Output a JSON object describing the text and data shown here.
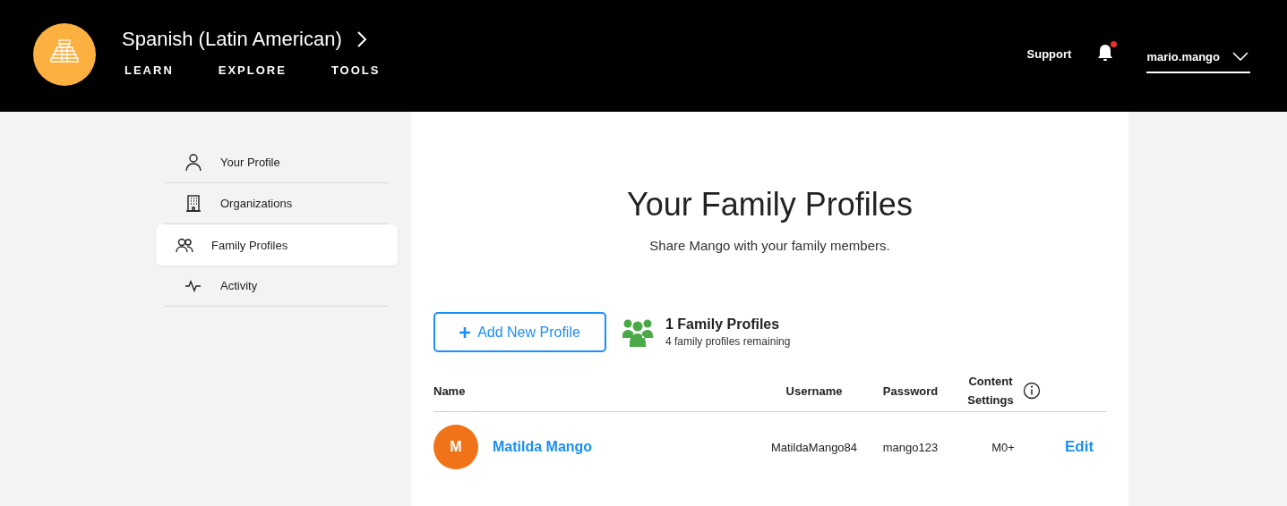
{
  "header": {
    "course": "Spanish (Latin American)",
    "nav": [
      {
        "label": "LEARN"
      },
      {
        "label": "EXPLORE"
      },
      {
        "label": "TOOLS"
      }
    ],
    "support": "Support",
    "notifications": {
      "unread": true
    },
    "user": "mario.mango"
  },
  "sidebar": {
    "items": [
      {
        "label": "Your Profile",
        "selected": false
      },
      {
        "label": "Organizations",
        "selected": false
      },
      {
        "label": "Family Profiles",
        "selected": true
      },
      {
        "label": "Activity",
        "selected": false
      }
    ]
  },
  "main": {
    "title": "Your Family Profiles",
    "subtitle": "Share Mango with your family members.",
    "add_button": "Add New Profile",
    "count_title": "1 Family Profiles",
    "count_note": "4 family profiles remaining",
    "table": {
      "columns": [
        "Name",
        "Username",
        "Password",
        "Content Settings"
      ],
      "rows": [
        {
          "initial": "M",
          "name": "Matilda Mango",
          "username": "MatildaMango84",
          "password": "mango123",
          "content": "M0+",
          "action": "Edit"
        }
      ]
    }
  }
}
